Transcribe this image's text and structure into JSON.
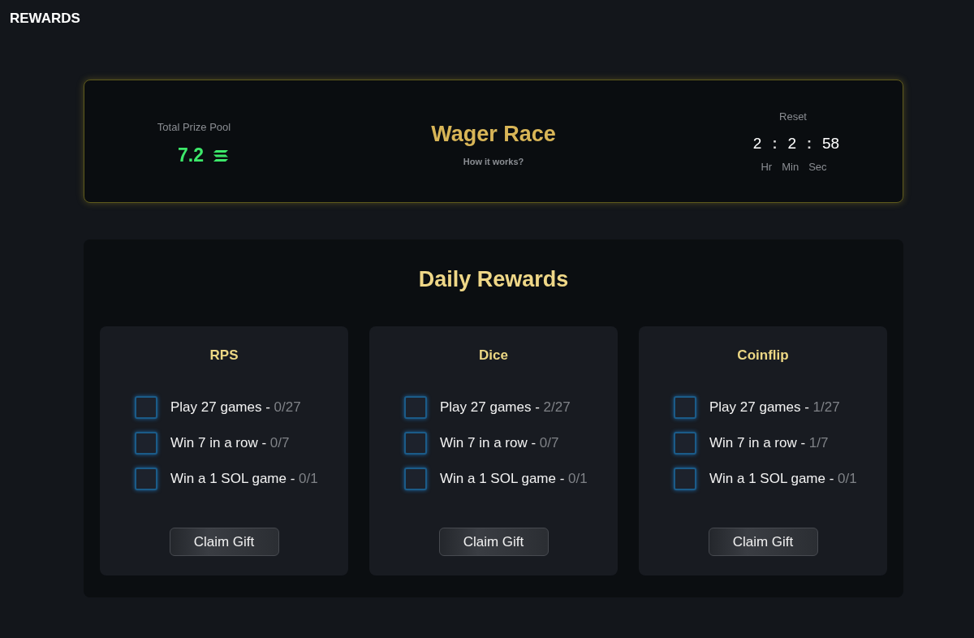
{
  "header": {
    "title": "REWARDS"
  },
  "wager_race": {
    "prize_pool": {
      "label": "Total Prize Pool",
      "amount": "7.2"
    },
    "title": "Wager Race",
    "link": "How it works?",
    "reset": {
      "label": "Reset",
      "segments": [
        {
          "kind": "value",
          "text": "2"
        },
        {
          "kind": "separator",
          "text": ":"
        },
        {
          "kind": "value",
          "text": "2"
        },
        {
          "kind": "separator",
          "text": ":"
        },
        {
          "kind": "value",
          "text": "58"
        }
      ],
      "units": [
        "Hr",
        "Min",
        "Sec"
      ]
    }
  },
  "daily_rewards": {
    "title": "Daily Rewards",
    "games": [
      {
        "name": "RPS",
        "tasks": [
          {
            "label": "Play 27 games -",
            "progress": "0/27",
            "checked": false
          },
          {
            "label": "Win 7 in a row -",
            "progress": "0/7",
            "checked": false
          },
          {
            "label": "Win a 1 SOL game -",
            "progress": "0/1",
            "checked": false
          }
        ],
        "button": "Claim Gift"
      },
      {
        "name": "Dice",
        "tasks": [
          {
            "label": "Play 27 games -",
            "progress": "2/27",
            "checked": false
          },
          {
            "label": "Win 7 in a row -",
            "progress": "0/7",
            "checked": false
          },
          {
            "label": "Win a 1 SOL game -",
            "progress": "0/1",
            "checked": false
          }
        ],
        "button": "Claim Gift"
      },
      {
        "name": "Coinflip",
        "tasks": [
          {
            "label": "Play 27 games -",
            "progress": "1/27",
            "checked": false
          },
          {
            "label": "Win 7 in a row -",
            "progress": "1/7",
            "checked": false
          },
          {
            "label": "Win a 1 SOL game -",
            "progress": "0/1",
            "checked": false
          }
        ],
        "button": "Claim Gift"
      }
    ]
  }
}
